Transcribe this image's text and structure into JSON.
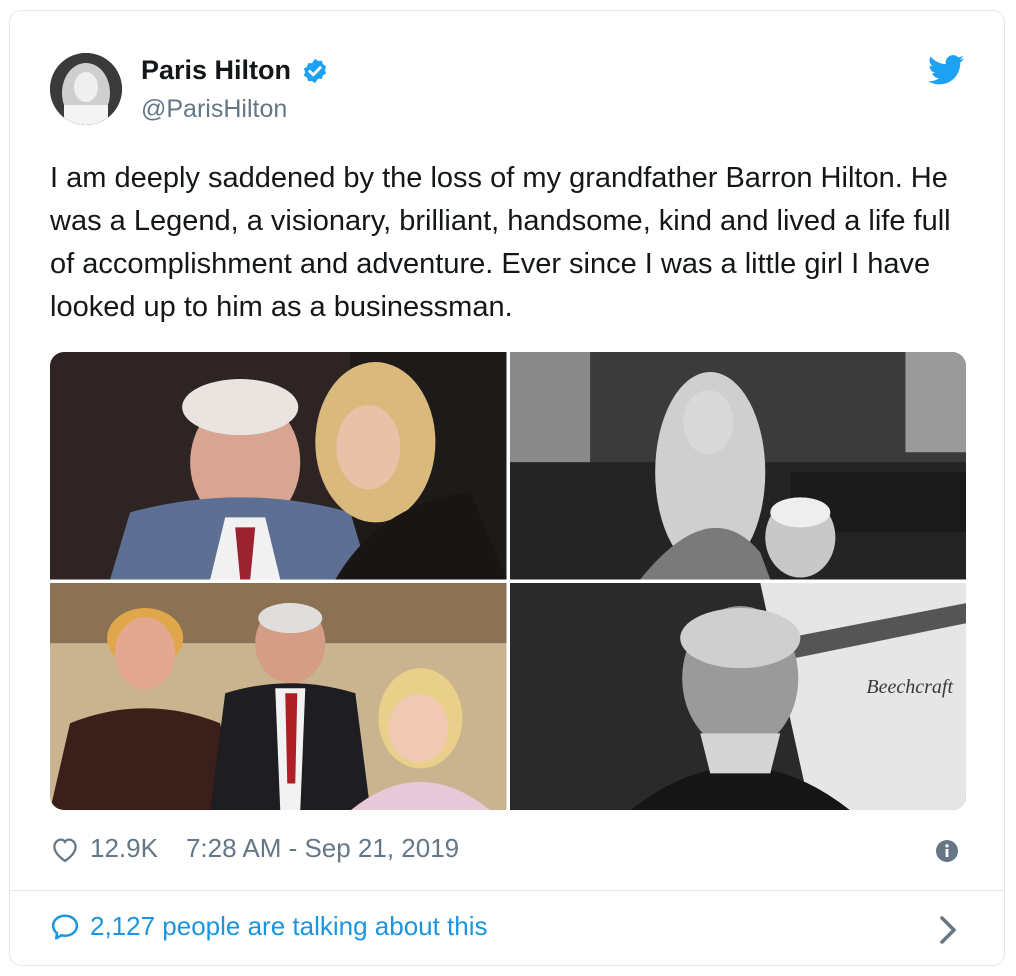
{
  "tweet": {
    "author_name": "Paris Hilton",
    "author_handle": "@ParisHilton",
    "text": "I am deeply saddened by the loss of my grandfather Barron Hilton. He was a Legend, a visionary, brilliant, handsome, kind and lived a life full of accomplishment and adventure. Ever since I was a little girl I have looked up to him as a businessman.",
    "likes": "12.9K",
    "timestamp": "7:28 AM - Sep 21, 2019",
    "talking": "2,127 people are talking about this"
  },
  "photos": {
    "p4_sign": "Beechcraft"
  },
  "colors": {
    "accent": "#1da1f2",
    "link": "#1b95e0",
    "muted": "#657786",
    "border": "#e1e8ed"
  },
  "icons": [
    "verified-badge-icon",
    "twitter-bird-icon",
    "heart-icon",
    "info-icon",
    "speech-bubble-icon",
    "chevron-right-icon"
  ]
}
